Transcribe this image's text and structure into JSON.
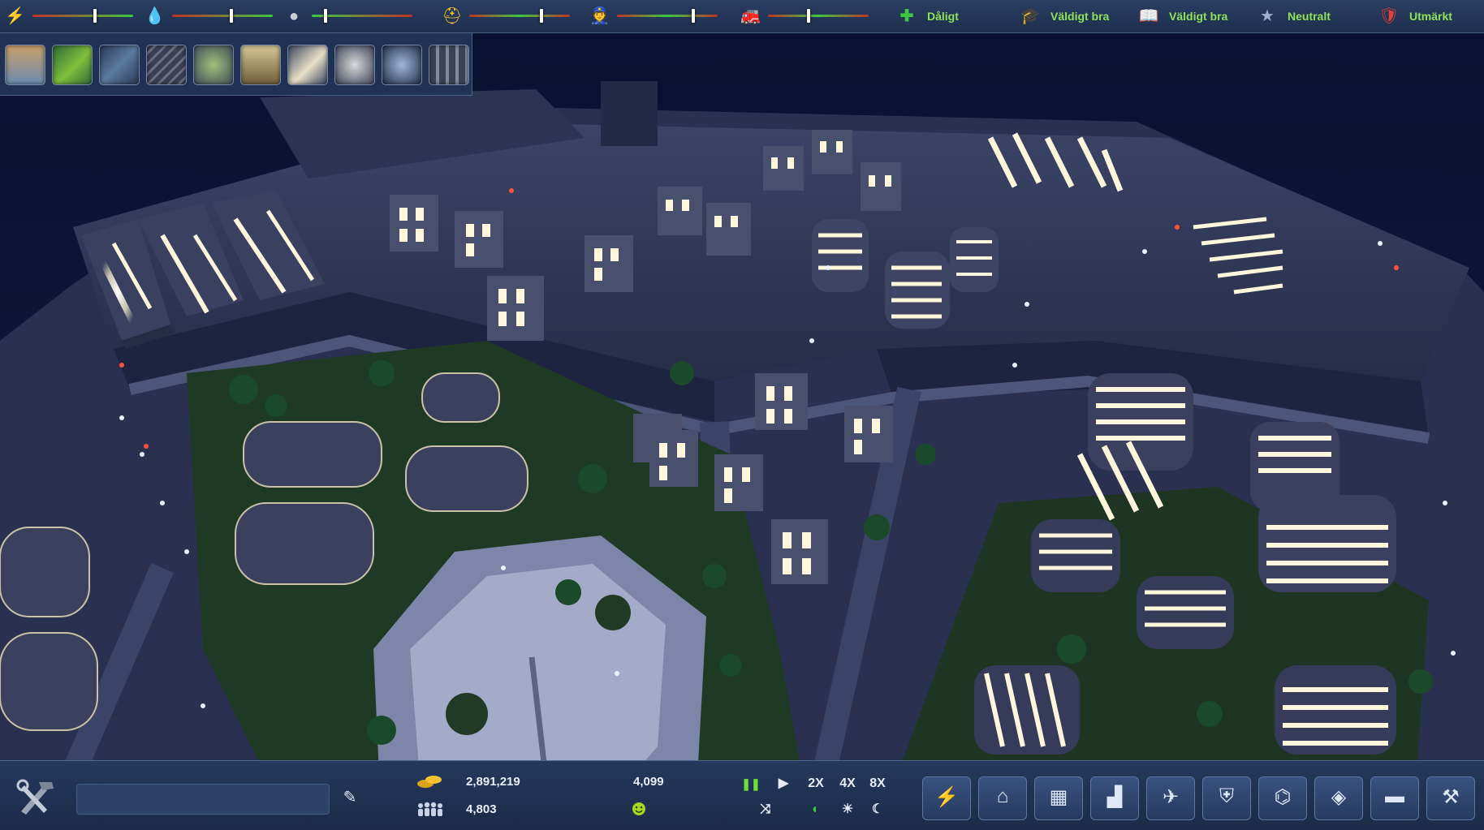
{
  "top_bar": {
    "meters": [
      {
        "icon": "lightning-icon",
        "level": 0.62,
        "color": "#f2c230"
      },
      {
        "icon": "water-drop-icon",
        "level": 0.59,
        "color": "#3c9cf2"
      },
      {
        "icon": "garbage-bag-icon",
        "level": 0.14,
        "color": "#c8ccd4"
      },
      {
        "icon": "worker-helmet-icon",
        "level": 0.72,
        "color": "#f2c230"
      },
      {
        "icon": "police-icon",
        "level": 0.76,
        "color": "#3c6ee0"
      },
      {
        "icon": "firefighter-icon",
        "level": 0.4,
        "color": "#d23a2a"
      }
    ],
    "statuses": [
      {
        "icon": "health-cross-icon",
        "label": "Dåligt"
      },
      {
        "icon": "graduation-cap-icon",
        "label": "Väldigt bra"
      },
      {
        "icon": "open-book-icon",
        "label": "Väldigt bra"
      },
      {
        "icon": "entertainment-icon",
        "label": "Neutralt"
      },
      {
        "icon": "crime-shield-icon",
        "label": "Utmärkt"
      }
    ]
  },
  "category_bar": {
    "items": [
      {
        "icon": "city-buildings-icon"
      },
      {
        "icon": "terrain-landscape-icon"
      },
      {
        "icon": "roads-icon"
      },
      {
        "icon": "rail-tracks-icon"
      },
      {
        "icon": "money-finance-icon"
      },
      {
        "icon": "statistics-graph-icon"
      },
      {
        "icon": "policies-document-icon"
      },
      {
        "icon": "tools-icon"
      },
      {
        "icon": "research-flask-icon"
      },
      {
        "icon": "library-books-icon"
      }
    ]
  },
  "bottom_bar": {
    "city_name_value": "",
    "money": "2,891,219",
    "population": "4,803",
    "happiness_count": "4,099",
    "speed_controls": {
      "pause": "❚❚",
      "play": "▶",
      "speed_2x": "2X",
      "speed_4x": "4X",
      "speed_8x": "8X"
    },
    "build_categories": [
      {
        "icon": "power-plant-icon"
      },
      {
        "icon": "residential-icon"
      },
      {
        "icon": "commercial-icon"
      },
      {
        "icon": "industrial-icon"
      },
      {
        "icon": "transport-icon"
      },
      {
        "icon": "services-icon"
      },
      {
        "icon": "government-icon"
      },
      {
        "icon": "education-icon"
      },
      {
        "icon": "warehouse-icon"
      },
      {
        "icon": "demolish-bulldozer-icon"
      }
    ]
  },
  "colors": {
    "status_text": "#8ee25a",
    "panel": "#233659",
    "night_sky": "#0b1230",
    "window_glow": "#fff6dc"
  }
}
